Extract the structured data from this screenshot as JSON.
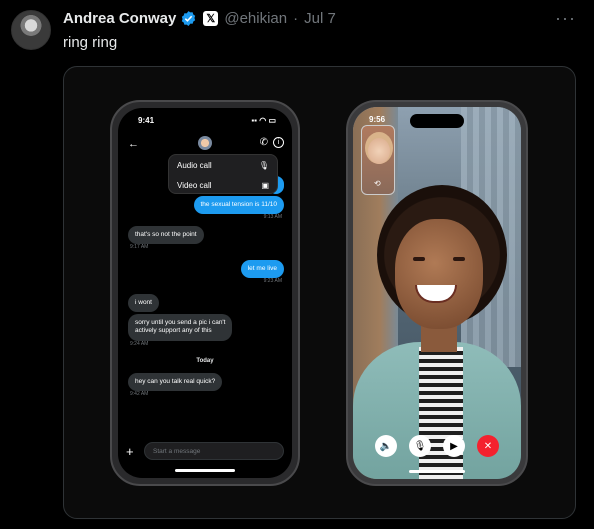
{
  "tweet": {
    "author_name": "Andrea Conway",
    "handle": "@ehikian",
    "separator": "·",
    "date": "Jul 7",
    "text": "ring ring",
    "more_label": "···",
    "x_badge": "𝕏",
    "colors": {
      "verified": "#1d9bf0",
      "background": "#000000",
      "muted": "#71767b"
    }
  },
  "phone_chat": {
    "time": "9:41",
    "menu": [
      {
        "label": "Audio call",
        "icon": "microphone-icon"
      },
      {
        "label": "Video call",
        "icon": "video-icon"
      }
    ],
    "messages": [
      {
        "text": "the sexual tension is 11/10",
        "side": "out",
        "time": "9:13 AM"
      },
      {
        "text": "that's so not the point",
        "side": "in",
        "time": "9:17 AM"
      },
      {
        "text": "let me live",
        "side": "out",
        "time": "9:23 AM"
      },
      {
        "text": "i wont",
        "side": "in",
        "time": ""
      },
      {
        "text": "sorry until you send a pic i can't\nactively support any of this",
        "side": "in",
        "time": "9:24 AM"
      },
      {
        "text": "hey can you talk real quick?",
        "side": "in",
        "time": "9:42 AM"
      }
    ],
    "today_label": "Today",
    "composer_placeholder": "Start a message",
    "plus_label": "+"
  },
  "phone_video": {
    "time": "9:56",
    "controls": [
      "speaker-icon",
      "microphone-icon",
      "camera-icon",
      "end-call-icon"
    ],
    "colors": {
      "end_call": "#f4212e"
    }
  }
}
